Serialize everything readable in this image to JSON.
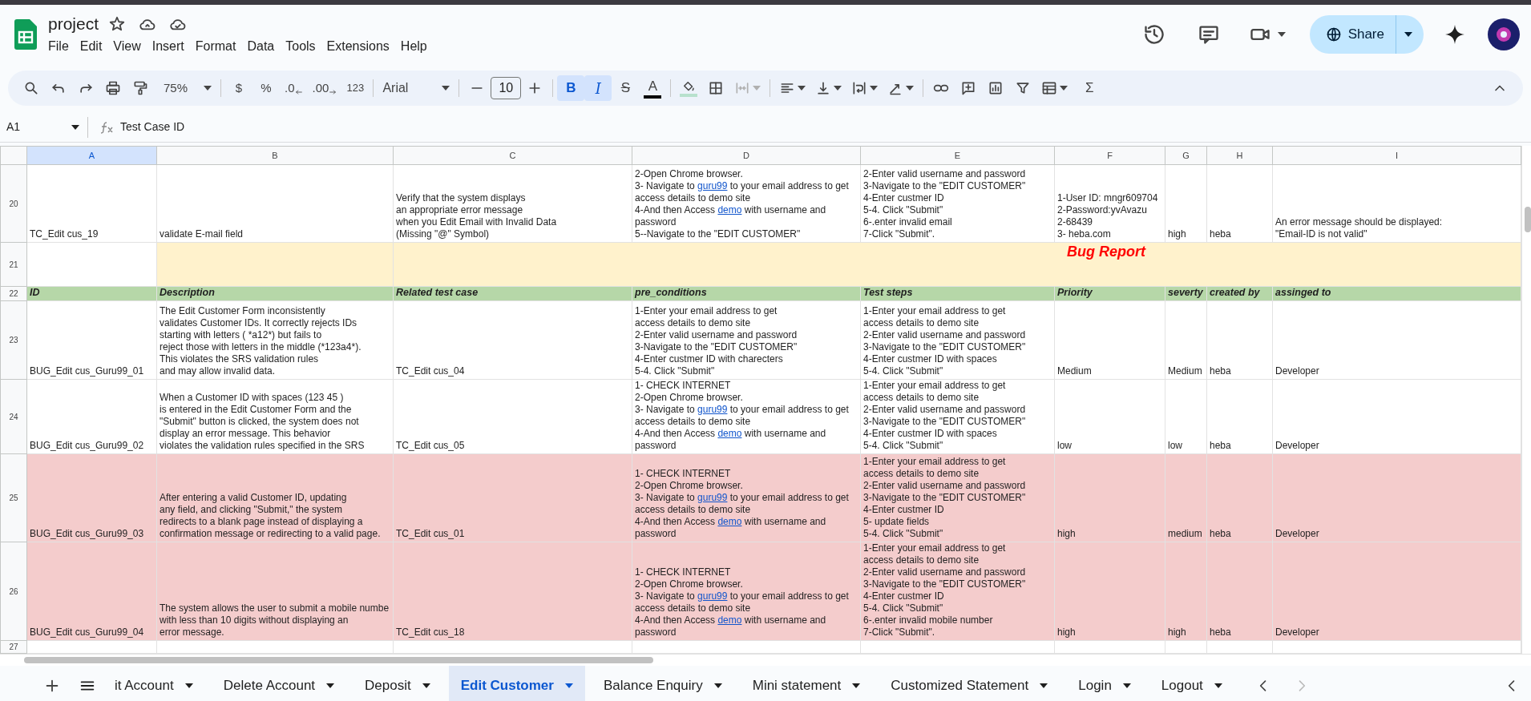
{
  "document": {
    "title": "project",
    "menu": [
      "File",
      "Edit",
      "View",
      "Insert",
      "Format",
      "Data",
      "Tools",
      "Extensions",
      "Help"
    ],
    "share_label": "Share"
  },
  "toolbar": {
    "zoom": "75%",
    "currency": "$",
    "percent": "%",
    "decrease_decimals": ".0",
    "increase_decimals": ".00",
    "number_format": "123",
    "font": "Arial",
    "font_size": "10",
    "bold_label": "B",
    "bold": true,
    "italic_label": "I",
    "italic": true,
    "strikethrough_label": "S",
    "text_color_label": "A",
    "functions_label": "Σ"
  },
  "formula_bar": {
    "cell_ref": "A1",
    "content": "Test Case ID"
  },
  "columns": [
    {
      "label": "A",
      "selected": true
    },
    {
      "label": "B",
      "selected": false
    },
    {
      "label": "C",
      "selected": false
    },
    {
      "label": "D",
      "selected": false
    },
    {
      "label": "E",
      "selected": false
    },
    {
      "label": "F",
      "selected": false
    },
    {
      "label": "G",
      "selected": false
    },
    {
      "label": "H",
      "selected": false
    },
    {
      "label": "I",
      "selected": false
    }
  ],
  "rows": [
    {
      "number": "20",
      "kind": "data",
      "color": "#ffffff",
      "cells": {
        "A": [
          "TC_Edit cus_19"
        ],
        "B": [
          "validate E-mail field"
        ],
        "C": [
          "Verify that the system displays",
          "an appropriate error message",
          "when you Edit Email with Invalid Data",
          " (Missing \"@\" Symbol)"
        ],
        "D": [
          "2-Open Chrome browser.",
          [
            {
              "text": "3- Navigate to ",
              "link": false
            },
            {
              "text": "guru99",
              "link": true
            },
            {
              "text": " to your email address to get",
              "link": false
            }
          ],
          "access details to demo site",
          [
            {
              "text": "4-And then Access ",
              "link": false
            },
            {
              "text": "demo",
              "link": true
            },
            {
              "text": " with username and",
              "link": false
            }
          ],
          "password",
          "5--Navigate to the \"EDIT CUSTOMER\""
        ],
        "E": [
          "2-Enter valid username and password",
          "3-Navigate to the \"EDIT CUSTOMER\"",
          "4-Enter custmer ID",
          "5-4. Click \"Submit\"",
          "6-.enter invalid email",
          "7-Click \"Submit\"."
        ],
        "F": [
          "1-User ID: mngr609704",
          "2-Password:yvAvazu",
          "2-68439",
          "3- heba.com"
        ],
        "G": [
          "high"
        ],
        "H": [
          "heba"
        ],
        "I": [
          "An error message should be displayed:",
          "\"Email-ID is not valid\""
        ]
      }
    },
    {
      "number": "21",
      "kind": "banner",
      "color": "#fff2cc",
      "title": "Bug Report"
    },
    {
      "number": "22",
      "kind": "header",
      "color": "#b6d7a8",
      "cells": {
        "A": "ID",
        "B": "Description",
        "C": "Related test case",
        "D": "pre_conditions",
        "E": "Test steps",
        "F": "Priority",
        "G": "severty",
        "H": "created by",
        "I": "assinged to"
      }
    },
    {
      "number": "23",
      "kind": "data",
      "color": "#ffffff",
      "cells": {
        "A": [
          "BUG_Edit cus_Guru99_01"
        ],
        "B": [
          "The Edit Customer Form inconsistently",
          "validates Customer IDs. It correctly rejects IDs",
          "starting with letters ( *a12*) but fails to",
          "reject those with letters in the middle (*123a4*).",
          "This violates the SRS validation rules",
          "and may allow invalid data."
        ],
        "C": [
          "TC_Edit cus_04"
        ],
        "D": [
          "1-Enter your email address to get",
          "access details to demo site",
          "2-Enter valid username and password",
          "3-Navigate to the \"EDIT CUSTOMER\"",
          "4-Enter custmer ID with charecters",
          "5-4. Click \"Submit\""
        ],
        "E": [
          "1-Enter your email address to get",
          "access details to demo site",
          "2-Enter valid username and password",
          "3-Navigate to the \"EDIT CUSTOMER\"",
          "4-Enter custmer ID with spaces",
          "5-4. Click \"Submit\""
        ],
        "F": [
          "Medium"
        ],
        "G": [
          "Medium"
        ],
        "H": [
          "heba"
        ],
        "I": [
          "Developer"
        ]
      }
    },
    {
      "number": "24",
      "kind": "data",
      "color": "#ffffff",
      "cells": {
        "A": [
          "BUG_Edit cus_Guru99_02"
        ],
        "B": [
          "When a Customer ID with spaces (123  45 )",
          "is entered in the Edit Customer Form and the",
          "\"Submit\" button is clicked, the system does not",
          "display an error message. This behavior",
          "violates the validation rules specified in the SRS"
        ],
        "C": [
          "TC_Edit cus_05"
        ],
        "D": [
          "1- CHECK INTERNET",
          "2-Open Chrome browser.",
          [
            {
              "text": "3- Navigate to ",
              "link": false
            },
            {
              "text": "guru99",
              "link": true
            },
            {
              "text": " to your email address to get",
              "link": false
            }
          ],
          "access details to demo site",
          [
            {
              "text": "4-And then Access ",
              "link": false
            },
            {
              "text": "demo",
              "link": true
            },
            {
              "text": " with username and",
              "link": false
            }
          ],
          "password"
        ],
        "E": [
          "1-Enter your email address to get",
          "access details to demo site",
          "2-Enter valid username and password",
          "3-Navigate to the \"EDIT CUSTOMER\"",
          "4-Enter custmer ID with spaces",
          "5-4. Click \"Submit\""
        ],
        "F": [
          "low"
        ],
        "G": [
          "low"
        ],
        "H": [
          "heba"
        ],
        "I": [
          "Developer"
        ]
      }
    },
    {
      "number": "25",
      "kind": "data",
      "color": "#f4cccc",
      "cells": {
        "A": [
          "BUG_Edit cus_Guru99_03"
        ],
        "B": [
          "After entering a valid Customer ID, updating",
          "any field, and clicking \"Submit,\" the system",
          "redirects to a blank page instead of displaying a",
          "confirmation message or redirecting to a valid page."
        ],
        "C": [
          "TC_Edit cus_01"
        ],
        "D": [
          "1- CHECK INTERNET",
          "2-Open Chrome browser.",
          [
            {
              "text": "3- Navigate to ",
              "link": false
            },
            {
              "text": "guru99",
              "link": true
            },
            {
              "text": " to your email address to get",
              "link": false
            }
          ],
          "access details to demo site",
          [
            {
              "text": "4-And then Access ",
              "link": false
            },
            {
              "text": "demo",
              "link": true
            },
            {
              "text": " with username and",
              "link": false
            }
          ],
          "password"
        ],
        "E": [
          "1-Enter your email address to get",
          "access details to demo site",
          "2-Enter valid username and password",
          "3-Navigate to the \"EDIT CUSTOMER\"",
          "4-Enter custmer ID",
          "5- update fields",
          "5-4. Click \"Submit\""
        ],
        "F": [
          "high"
        ],
        "G": [
          "medium"
        ],
        "H": [
          "heba"
        ],
        "I": [
          "Developer"
        ]
      }
    },
    {
      "number": "26",
      "kind": "data",
      "color": "#f4cccc",
      "cells": {
        "A": [
          "BUG_Edit cus_Guru99_04"
        ],
        "B": [
          "The system allows the user to submit a mobile numbe",
          "with less than 10 digits without displaying an",
          "error message."
        ],
        "C": [
          "TC_Edit cus_18"
        ],
        "D": [
          "1- CHECK INTERNET",
          "2-Open Chrome browser.",
          [
            {
              "text": "3- Navigate to ",
              "link": false
            },
            {
              "text": "guru99",
              "link": true
            },
            {
              "text": " to your email address to get",
              "link": false
            }
          ],
          "access details to demo site",
          [
            {
              "text": "4-And then Access ",
              "link": false
            },
            {
              "text": "demo",
              "link": true
            },
            {
              "text": " with username and",
              "link": false
            }
          ],
          "password"
        ],
        "E": [
          "1-Enter your email address to get",
          "access details to demo site",
          "2-Enter valid username and password",
          "3-Navigate to the \"EDIT CUSTOMER\"",
          "4-Enter custmer ID",
          "5-4. Click \"Submit\"",
          "6-.enter invalid mobile number",
          "7-Click \"Submit\"."
        ],
        "F": [
          "high"
        ],
        "G": [
          "high"
        ],
        "H": [
          "heba"
        ],
        "I": [
          "Developer"
        ]
      }
    },
    {
      "number": "27",
      "kind": "empty"
    }
  ],
  "sheet_tabs": [
    {
      "label": "it Account",
      "selected": false
    },
    {
      "label": "Delete Account",
      "selected": false
    },
    {
      "label": "Deposit",
      "selected": false
    },
    {
      "label": "Edit Customer",
      "selected": true
    },
    {
      "label": "Balance Enquiry",
      "selected": false
    },
    {
      "label": "Mini statement",
      "selected": false
    },
    {
      "label": "Customized Statement",
      "selected": false
    },
    {
      "label": "Login",
      "selected": false
    },
    {
      "label": "Logout",
      "selected": false
    }
  ]
}
